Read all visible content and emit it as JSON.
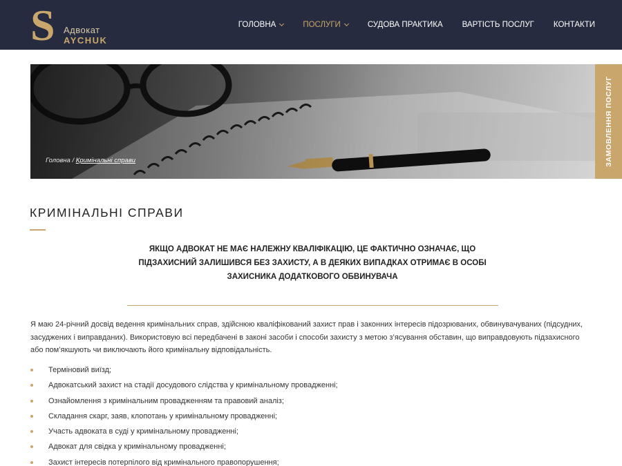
{
  "brand": {
    "letter": "S",
    "top": "Адвокат",
    "bottom": "AYCHUK",
    "accent": "#c9a66b",
    "header_bg": "#262b3f"
  },
  "nav": [
    {
      "label": "ГОЛОВНА",
      "dropdown": true,
      "active": false
    },
    {
      "label": "ПОСЛУГИ",
      "dropdown": true,
      "active": true
    },
    {
      "label": "СУДОВА ПРАКТИКА",
      "dropdown": false,
      "active": false
    },
    {
      "label": "ВАРТІСТЬ ПОСЛУГ",
      "dropdown": false,
      "active": false
    },
    {
      "label": "КОНТАКТИ",
      "dropdown": false,
      "active": false
    }
  ],
  "breadcrumb": {
    "home": "Головна",
    "separator": " / ",
    "current": "Кримінальні справи"
  },
  "order_tab": "ЗАМОВЛЕННЯ ПОСЛУГ",
  "page": {
    "title": "КРИМІНАЛЬНІ СПРАВИ",
    "quote_lines": [
      "ЯКЩО АДВОКАТ НЕ МАЄ НАЛЕЖНУ КВАЛІФІКАЦІЮ, ЦЕ ФАКТИЧНО ОЗНАЧАЄ, ЩО",
      "ПІДЗАХИСНИЙ ЗАЛИШИВСЯ БЕЗ ЗАХИСТУ, А В ДЕЯКИХ ВИПАДКАХ ОТРИМАЄ В ОСОБІ",
      "ЗАХИСНИКА ДОДАТКОВОГО ОБВИНУВАЧА"
    ],
    "intro": "Я маю 24-річний досвід ведення кримінальних справ, здійснюю кваліфікований захист прав і законних інтересів підозрюваних, обвинувачуваних (підсудних, засуджених і виправданих). Використовую всі передбачені в законі засоби і способи захисту  з метою з’ясування обставин, що виправдовують підзахисного або пом’якшують чи виключають його кримінальну відповідальність.",
    "services": [
      "Терміновий виїзд;",
      "Адвокатський захист на стадії досудового слідства у кримінальному провадженні;",
      "Ознайомлення з кримінальним провадженням та правовий аналіз;",
      "Складання скарг, заяв, клопотань у кримінальному провадженні;",
      "Участь адвоката в суді у кримінальному провадженні;",
      "Адвокат для свідка у кримінальному провадженні;",
      "Захист інтересів потерпілого від кримінального правопорушення;"
    ]
  }
}
